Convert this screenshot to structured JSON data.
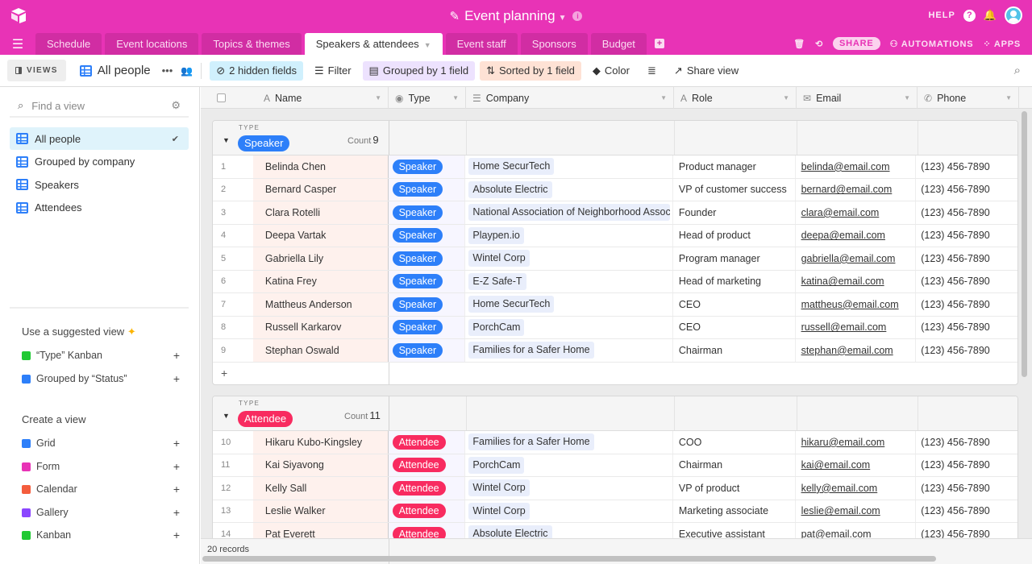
{
  "app": {
    "title": "Event planning",
    "help_label": "HELP",
    "tabs": [
      {
        "label": "Schedule",
        "active": false
      },
      {
        "label": "Event locations",
        "active": false
      },
      {
        "label": "Topics & themes",
        "active": false
      },
      {
        "label": "Speakers & attendees",
        "active": true
      },
      {
        "label": "Event staff",
        "active": false
      },
      {
        "label": "Sponsors",
        "active": false
      },
      {
        "label": "Budget",
        "active": false
      }
    ],
    "share_label": "SHARE",
    "automations_label": "AUTOMATIONS",
    "apps_label": "APPS",
    "brand_color": "#e833b6"
  },
  "toolbar": {
    "views_label": "VIEWS",
    "current_view": "All people",
    "hidden_fields": "2 hidden fields",
    "filter": "Filter",
    "grouped": "Grouped by 1 field",
    "sorted": "Sorted by 1 field",
    "color": "Color",
    "share_view": "Share view"
  },
  "sidebar": {
    "search_placeholder": "Find a view",
    "views": [
      {
        "label": "All people",
        "active": true
      },
      {
        "label": "Grouped by company",
        "active": false
      },
      {
        "label": "Speakers",
        "active": false
      },
      {
        "label": "Attendees",
        "active": false
      }
    ],
    "suggested_title": "Use a suggested view",
    "suggested": [
      {
        "label": "“Type” Kanban",
        "icon": "kanban",
        "color": "#20c933"
      },
      {
        "label": "Grouped by “Status”",
        "icon": "grid",
        "color": "#2d7ff9"
      }
    ],
    "create_title": "Create a view",
    "create": [
      {
        "label": "Grid",
        "icon": "grid",
        "color": "#2d7ff9"
      },
      {
        "label": "Form",
        "icon": "form",
        "color": "#e833b6"
      },
      {
        "label": "Calendar",
        "icon": "calendar",
        "color": "#f45d3d"
      },
      {
        "label": "Gallery",
        "icon": "gallery",
        "color": "#8b46ff"
      },
      {
        "label": "Kanban",
        "icon": "kanban",
        "color": "#20c933"
      }
    ]
  },
  "grid": {
    "columns": [
      "Name",
      "Type",
      "Company",
      "Role",
      "Email",
      "Phone"
    ],
    "group_field_label": "TYPE",
    "count_label": "Count",
    "groups": [
      {
        "name": "Speaker",
        "count": "9",
        "color": "#2d7ff9",
        "rows": [
          {
            "num": "1",
            "name": "Belinda Chen",
            "company": "Home SecurTech",
            "role": "Product manager",
            "email": "belinda@email.com",
            "phone": "(123) 456-7890"
          },
          {
            "num": "2",
            "name": "Bernard Casper",
            "company": "Absolute Electric",
            "role": "VP of customer success",
            "email": "bernard@email.com",
            "phone": "(123) 456-7890"
          },
          {
            "num": "3",
            "name": "Clara Rotelli",
            "company": "National Association of Neighborhood Associations",
            "role": "Founder",
            "email": "clara@email.com",
            "phone": "(123) 456-7890"
          },
          {
            "num": "4",
            "name": "Deepa Vartak",
            "company": "Playpen.io",
            "role": "Head of product",
            "email": "deepa@email.com",
            "phone": "(123) 456-7890"
          },
          {
            "num": "5",
            "name": "Gabriella Lily",
            "company": "Wintel Corp",
            "role": "Program manager",
            "email": "gabriella@email.com",
            "phone": "(123) 456-7890"
          },
          {
            "num": "6",
            "name": "Katina Frey",
            "company": "E-Z Safe-T",
            "role": "Head of marketing",
            "email": "katina@email.com",
            "phone": "(123) 456-7890"
          },
          {
            "num": "7",
            "name": "Mattheus Anderson",
            "company": "Home SecurTech",
            "role": "CEO",
            "email": "mattheus@email.com",
            "phone": "(123) 456-7890"
          },
          {
            "num": "8",
            "name": "Russell Karkarov",
            "company": "PorchCam",
            "role": "CEO",
            "email": "russell@email.com",
            "phone": "(123) 456-7890"
          },
          {
            "num": "9",
            "name": "Stephan Oswald",
            "company": "Families for a Safer Home",
            "role": "Chairman",
            "email": "stephan@email.com",
            "phone": "(123) 456-7890"
          }
        ]
      },
      {
        "name": "Attendee",
        "count": "11",
        "color": "#f82b60",
        "rows": [
          {
            "num": "10",
            "name": "Hikaru Kubo-Kingsley",
            "company": "Families for a Safer Home",
            "role": "COO",
            "email": "hikaru@email.com",
            "phone": "(123) 456-7890"
          },
          {
            "num": "11",
            "name": "Kai Siyavong",
            "company": "PorchCam",
            "role": "Chairman",
            "email": "kai@email.com",
            "phone": "(123) 456-7890"
          },
          {
            "num": "12",
            "name": "Kelly Sall",
            "company": "Wintel Corp",
            "role": "VP of product",
            "email": "kelly@email.com",
            "phone": "(123) 456-7890"
          },
          {
            "num": "13",
            "name": "Leslie Walker",
            "company": "Wintel Corp",
            "role": "Marketing associate",
            "email": "leslie@email.com",
            "phone": "(123) 456-7890"
          },
          {
            "num": "14",
            "name": "Pat Everett",
            "company": "Absolute Electric",
            "role": "Executive assistant",
            "email": "pat@email.com",
            "phone": "(123) 456-7890"
          }
        ]
      }
    ],
    "record_count": "20 records"
  }
}
